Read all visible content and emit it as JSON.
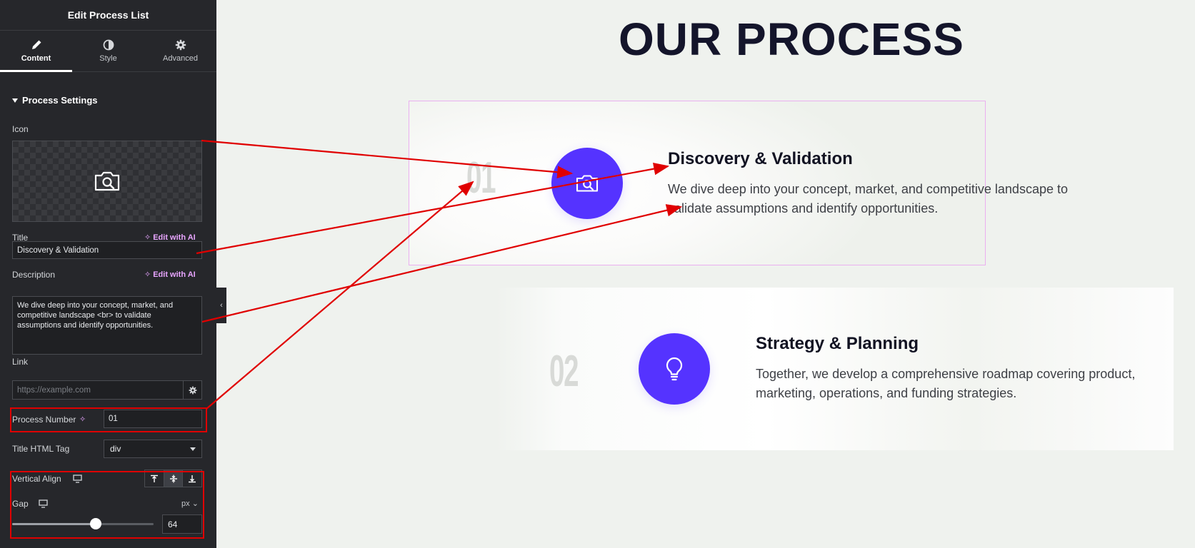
{
  "sidebar": {
    "header_title": "Edit Process List",
    "tabs": [
      {
        "label": "Content",
        "icon": "pencil-icon"
      },
      {
        "label": "Style",
        "icon": "half-circle-icon"
      },
      {
        "label": "Advanced",
        "icon": "gear-icon"
      }
    ],
    "section_title": "Process Settings",
    "icon_label": "Icon",
    "title_label": "Title",
    "edit_with_ai": "Edit with AI",
    "title_value": "Discovery & Validation",
    "description_label": "Description",
    "description_value": "We dive deep into your concept, market, and competitive landscape <br> to validate assumptions and identify opportunities.",
    "link_label": "Link",
    "link_placeholder": "https://example.com",
    "process_number_label": "Process Number",
    "process_number_value": "01",
    "title_html_tag_label": "Title HTML Tag",
    "title_html_tag_value": "div",
    "vertical_align_label": "Vertical Align",
    "vertical_align_selected": "middle",
    "gap_label": "Gap",
    "gap_unit": "px",
    "gap_value": "64",
    "gap_slider_fraction": 0.59
  },
  "canvas": {
    "heading": "OUR PROCESS",
    "cards": [
      {
        "number": "01",
        "icon": "camera-search-icon",
        "title": "Discovery & Validation",
        "description": "We dive deep into your concept, market, and competitive landscape to validate assumptions and identify opportunities."
      },
      {
        "number": "02",
        "icon": "lightbulb-icon",
        "title": "Strategy & Planning",
        "description": "Together, we develop a comprehensive roadmap covering product, marketing, operations, and funding strategies."
      }
    ]
  },
  "colors": {
    "accent": "#5533ff",
    "annotation_red": "#e00000",
    "ai_link": "#e8a5ff",
    "panel_bg": "#26272b"
  }
}
